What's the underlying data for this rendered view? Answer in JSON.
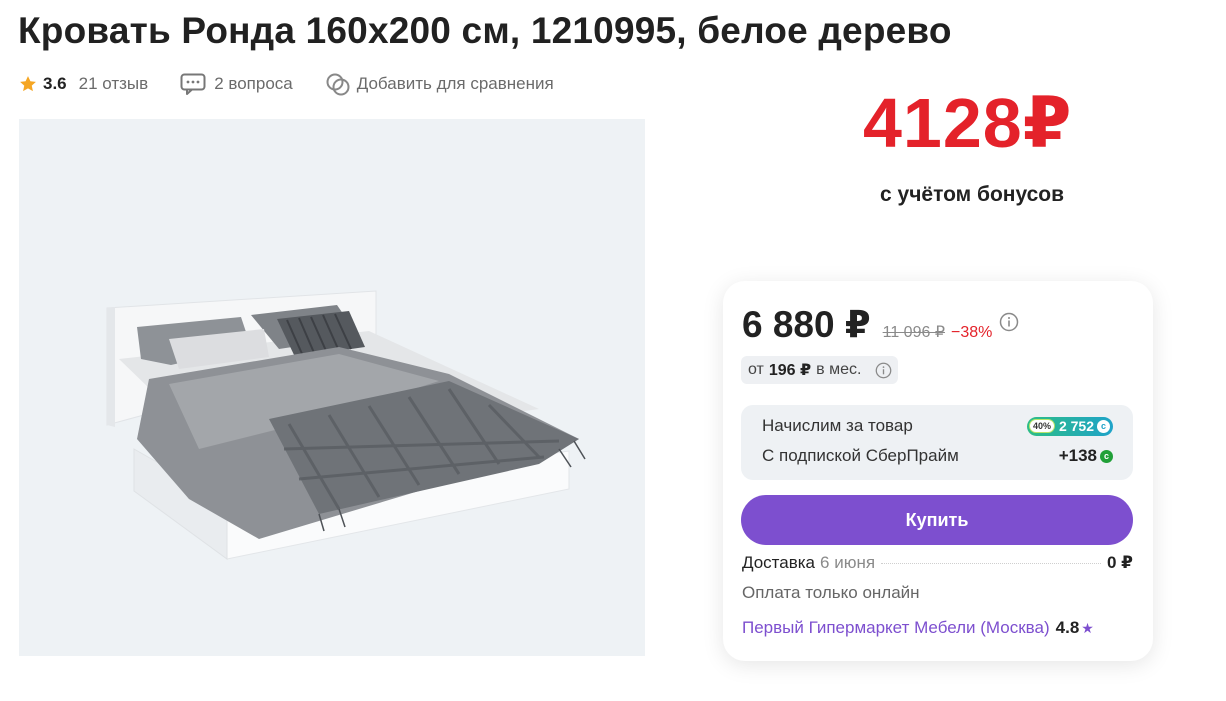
{
  "product": {
    "title": "Кровать Ронда 160х200 см, 1210995, белое дерево",
    "rating": "3.6",
    "reviews": "21 отзыв",
    "questions": "2 вопроса",
    "compare": "Добавить для сравнения"
  },
  "promo": {
    "price": "4128₽",
    "subtitle": "с учётом бонусов"
  },
  "offer": {
    "price": "6 880 ₽",
    "old_price": "11 096 ₽",
    "discount": "−38%",
    "installment_prefix": "от",
    "installment_amount": "196 ₽",
    "installment_suffix": "в мес.",
    "bonus_label": "Начислим за товар",
    "bonus_percent": "40%",
    "bonus_value": "2 752",
    "prime_label": "С подпиской СберПрайм",
    "prime_value": "+138",
    "coin_symbol": "с",
    "buy_label": "Купить",
    "delivery_label": "Доставка",
    "delivery_date": "6 июня",
    "delivery_cost": "0 ₽",
    "payment_note": "Оплата только онлайн",
    "seller_name": "Первый Гипермаркет Мебели (Москва)",
    "seller_rating": "4.8",
    "seller_star": "★"
  },
  "colors": {
    "promo_red": "#e4222a",
    "accent_purple": "#7d4fcf",
    "star_orange": "#f5a623",
    "bonus_green": "#21a038"
  },
  "icons": {
    "rating": "star-icon",
    "questions": "chat-icon",
    "compare": "compare-icon",
    "info": "info-icon",
    "bonus": "bonus-coin-icon"
  }
}
